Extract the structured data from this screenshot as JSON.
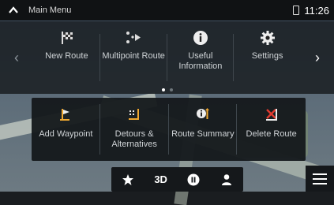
{
  "status_bar": {
    "title": "Main Menu",
    "time": "11:26"
  },
  "main_menu": {
    "items": [
      {
        "label": "New Route",
        "icon": "checkered-flag-icon"
      },
      {
        "label": "Multipoint Route",
        "icon": "multipoint-route-icon"
      },
      {
        "label": "Useful Information",
        "icon": "info-icon"
      },
      {
        "label": "Settings",
        "icon": "gear-icon"
      }
    ],
    "page_indicator": {
      "pages": 2,
      "active": 1
    }
  },
  "route_popup": {
    "items": [
      {
        "label": "Add Waypoint",
        "icon": "add-waypoint-icon"
      },
      {
        "label": "Detours & Alternatives",
        "icon": "detours-icon"
      },
      {
        "label": "Route Summary",
        "icon": "route-summary-icon"
      },
      {
        "label": "Delete Route",
        "icon": "delete-route-icon"
      }
    ]
  },
  "bottom_bar": {
    "view_mode": "3D"
  },
  "colors": {
    "accent": "#f0a830",
    "delete": "#e03a2f",
    "panel_bg": "#1e2428"
  }
}
